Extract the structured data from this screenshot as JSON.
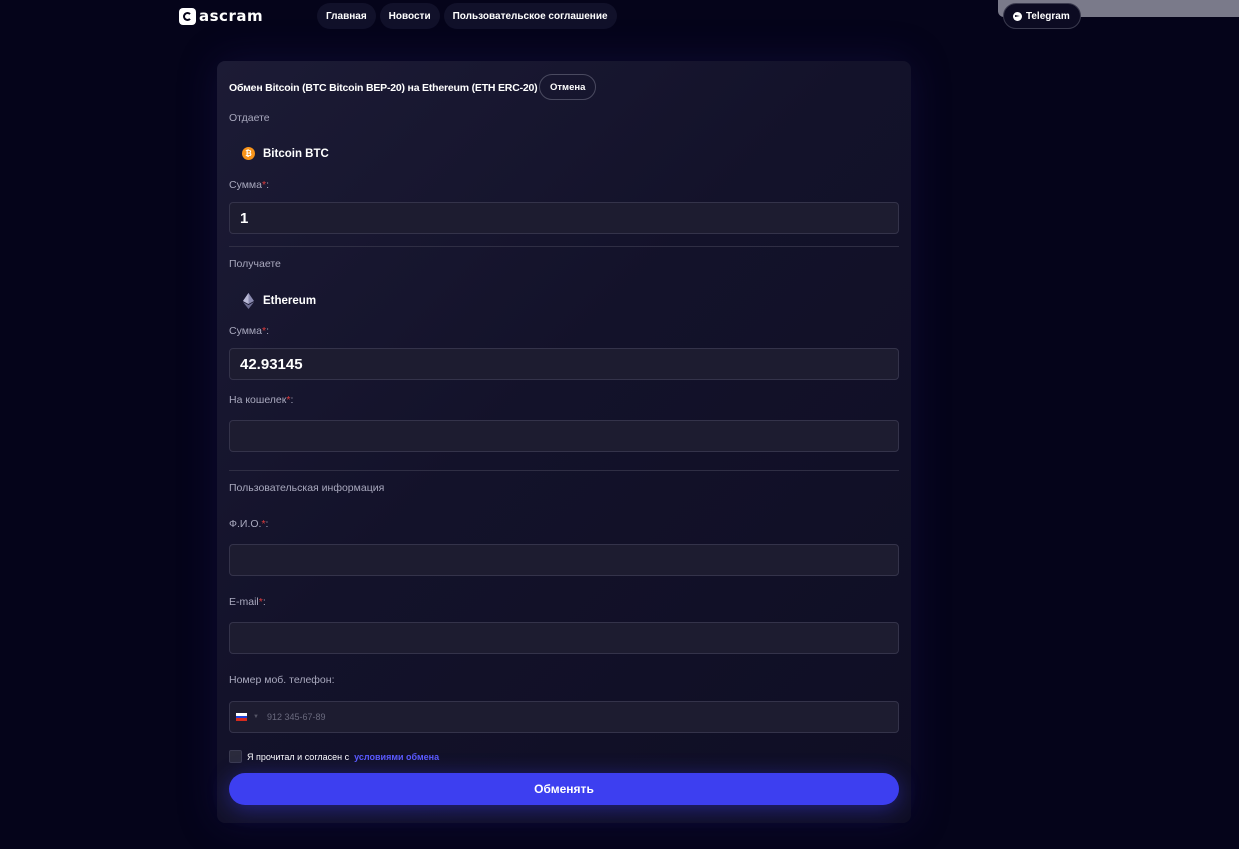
{
  "header": {
    "logo_text": "ascram",
    "nav": [
      {
        "label": "Главная"
      },
      {
        "label": "Новости"
      },
      {
        "label": "Пользовательское соглашение"
      }
    ],
    "telegram_label": "Telegram"
  },
  "exchange": {
    "title": "Обмен Bitcoin (BTC Bitcoin BEP-20) на Ethereum (ETH ERC-20)",
    "cancel_label": "Отмена",
    "give": {
      "section_label": "Отдаете",
      "currency": "Bitcoin BTC",
      "currency_icon": "bitcoin-icon",
      "amount_label": "Сумма",
      "amount_value": "1"
    },
    "receive": {
      "section_label": "Получаете",
      "currency": "Ethereum",
      "currency_icon": "ethereum-icon",
      "amount_label": "Сумма",
      "amount_value": "42.93145",
      "wallet_label": "На кошелек",
      "wallet_value": ""
    },
    "user_info": {
      "section_label": "Пользовательская информация",
      "name_label": "Ф.И.О.",
      "name_value": "",
      "email_label": "E-mail",
      "email_value": "",
      "phone_label": "Номер моб. телефон:",
      "phone_placeholder": "912 345-67-89"
    },
    "required_mark": "*",
    "label_suffix": ":",
    "agree_text": "Я прочитал и согласен с",
    "agree_link": "условиями обмена",
    "submit_label": "Обменять"
  },
  "colors": {
    "background": "#05041a",
    "accent": "#3d3ff0",
    "required": "#e03c3c",
    "link": "#5b5bff",
    "bitcoin": "#f7931a"
  }
}
